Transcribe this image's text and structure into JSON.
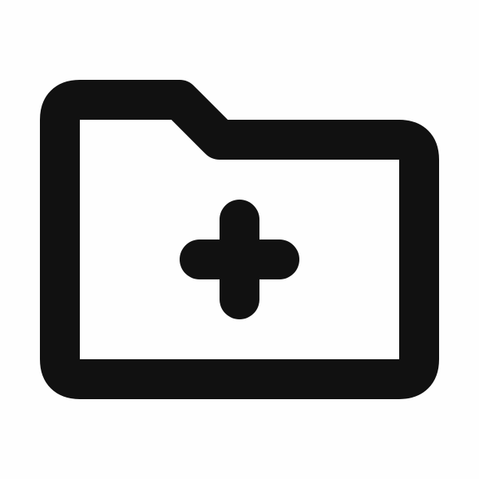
{
  "icon": {
    "name": "folder-add-icon",
    "stroke_color": "#111111",
    "background_color": "#fefefe"
  }
}
